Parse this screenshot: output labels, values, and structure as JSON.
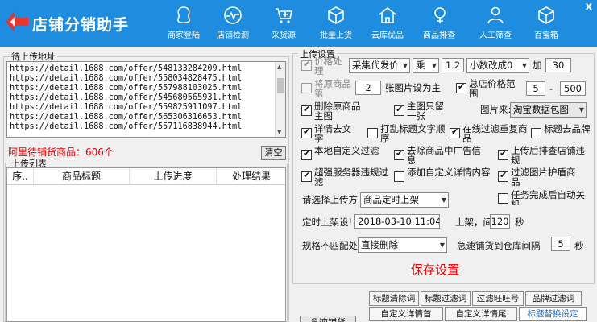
{
  "app": {
    "title": "店铺分销助手",
    "close": "x"
  },
  "nav": [
    {
      "label": "商家登陆",
      "icon": "user-icon"
    },
    {
      "label": "店铺检测",
      "icon": "pulse-icon"
    },
    {
      "label": "采货源",
      "icon": "cart-add-icon"
    },
    {
      "label": "批量上货",
      "icon": "box-icon"
    },
    {
      "label": "云库优品",
      "icon": "home-icon"
    },
    {
      "label": "商品排查",
      "icon": "search-icon"
    },
    {
      "label": "人工筛查",
      "icon": "person-icon"
    },
    {
      "label": "百宝箱",
      "icon": "cube-icon"
    }
  ],
  "left": {
    "pending_title": "待上传地址",
    "urls": [
      "https://detail.1688.com/offer/548133284209.html",
      "https://detail.1688.com/offer/558034828475.html",
      "https://detail.1688.com/offer/557988103025.html",
      "https://detail.1688.com/offer/545680565931.html",
      "https://detail.1688.com/offer/559825911097.html",
      "https://detail.1688.com/offer/565306316653.html",
      "https://detail.1688.com/offer/557116838944.html"
    ],
    "count_text": "阿里待铺货商品：606个",
    "clear_button": "清空",
    "upload_list_title": "上传列表",
    "columns": [
      "序..",
      "商品标题",
      "上传进度",
      "处理结果"
    ]
  },
  "settings": {
    "title": "上传设置",
    "price_process": "价格处理",
    "price_mode": "采集代发价",
    "op": "乘",
    "factor": "1.2",
    "decimal_mode": "小数改成0",
    "plus_label": "加",
    "plus_value": "30",
    "orig_label": "将原商品第",
    "orig_num": "2",
    "orig_suffix": "张图片设为主",
    "total_price": "总店价格范围",
    "price_min": "5",
    "price_dash": "-",
    "price_max": "500",
    "delete_main": "删除原商品主图",
    "keep_one": "主图只留一张",
    "image_source_label": "图片来:",
    "image_source": "淘宝数据包图",
    "detail_text": "详情去文字",
    "shuffle_title": "打乱标题文字顺序",
    "online_filter": "在线过滤重复商品",
    "title_brand": "标题去品牌",
    "local_filter": "本地自定义过滤",
    "ad_info": "去除商品中广告信息",
    "post_upload": "上传后排查店铺违规",
    "super_server": "超强服务器违规过滤",
    "add_detail": "添加自定义详情内容",
    "filter_image": "过滤图片护盾商品",
    "upload_mode_label": "请选择上传方",
    "upload_mode": "商品定时上架",
    "auto_close": "任务完成后自动关机",
    "timer_label": "定时上架设!",
    "timer_value": "2018-03-10 11:04",
    "interval_label": "上架，间",
    "interval_value": "120",
    "interval_unit": "秒",
    "mismatch_label": "规格不匹配处",
    "mismatch_mode": "直接删除",
    "warehouse_label": "急速铺货到仓库间隔",
    "warehouse_value": "5",
    "warehouse_unit": "秒",
    "save": "保存设置",
    "fast_button": "急速铺货"
  },
  "tabs_row1": [
    "标题清除词",
    "标题过滤词",
    "过滤旺旺号",
    "品牌过滤词"
  ],
  "tabs_row2": [
    "自定义详情首",
    "自定义详情尾",
    "标题替换设定"
  ]
}
